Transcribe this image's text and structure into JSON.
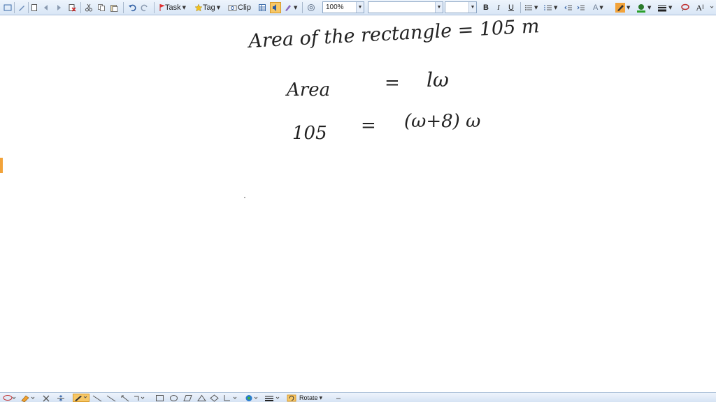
{
  "toolbar": {
    "task_label": "Task",
    "tag_label": "Tag",
    "clip_label": "Clip",
    "zoom_value": "100%",
    "font_name_value": "",
    "font_size_value": "",
    "bold_label": "B",
    "italic_label": "I",
    "underline_label": "U",
    "font_grow_label": "A",
    "accent_color": "#f2a33a"
  },
  "note": {
    "line1": "Area of the rectangle = 105 m",
    "line2_left": "Area",
    "line2_eq": "=",
    "line2_right": "lω",
    "line3_left": "105",
    "line3_eq": "=",
    "line3_right": "(ω+8) ω"
  },
  "bottombar": {
    "rotate_label": "Rotate"
  }
}
